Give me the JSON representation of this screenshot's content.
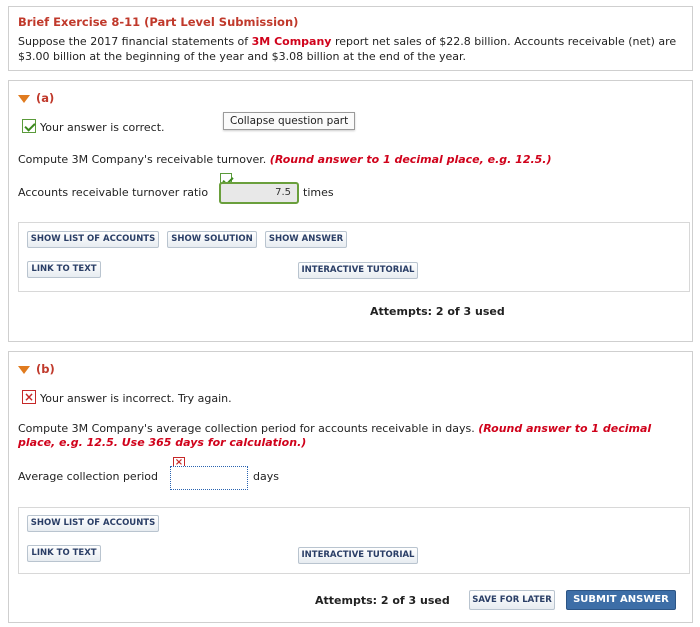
{
  "intro": {
    "title": "Brief Exercise 8-11 (Part Level Submission)",
    "text1": "Suppose the 2017 financial statements of ",
    "company": "3M Company",
    "text2": " report net sales of $22.8 billion. Accounts receivable (net) are",
    "text3": "$3.00 billion at the beginning of the year and $3.08 billion at the end of the year."
  },
  "part_a": {
    "label": "(a)",
    "status": "Your answer is correct.",
    "tooltip": "Collapse question part",
    "question": "Compute 3M Company's receivable turnover. ",
    "hint": "(Round answer to 1 decimal place, e.g. 12.5.)",
    "field_label": "Accounts receivable turnover ratio",
    "field_value": "7.5",
    "unit": "times",
    "buttons": {
      "show_list": "SHOW LIST OF ACCOUNTS",
      "show_solution": "SHOW SOLUTION",
      "show_answer": "SHOW ANSWER",
      "link_to_text": "LINK TO TEXT",
      "interactive_tutorial": "INTERACTIVE TUTORIAL"
    },
    "attempts": "Attempts: 2 of 3 used"
  },
  "part_b": {
    "label": "(b)",
    "status": "Your answer is incorrect.  Try again.",
    "question": "Compute 3M Company's average collection period for accounts receivable in days. ",
    "hint1": "(Round answer to 1 decimal",
    "hint2": "place, e.g. 12.5. Use 365 days for calculation.)",
    "field_label": "Average collection period",
    "field_value": "",
    "unit": "days",
    "buttons": {
      "show_list": "SHOW LIST OF ACCOUNTS",
      "link_to_text": "LINK TO TEXT",
      "interactive_tutorial": "INTERACTIVE TUTORIAL"
    },
    "attempts": "Attempts: 2 of 3 used",
    "save_for_later": "SAVE FOR LATER",
    "submit_answer": "SUBMIT ANSWER"
  },
  "colors": {
    "accent_red": "#d0021b",
    "submit_blue": "#3d6ea7",
    "correct_green": "#3c8a1e"
  }
}
